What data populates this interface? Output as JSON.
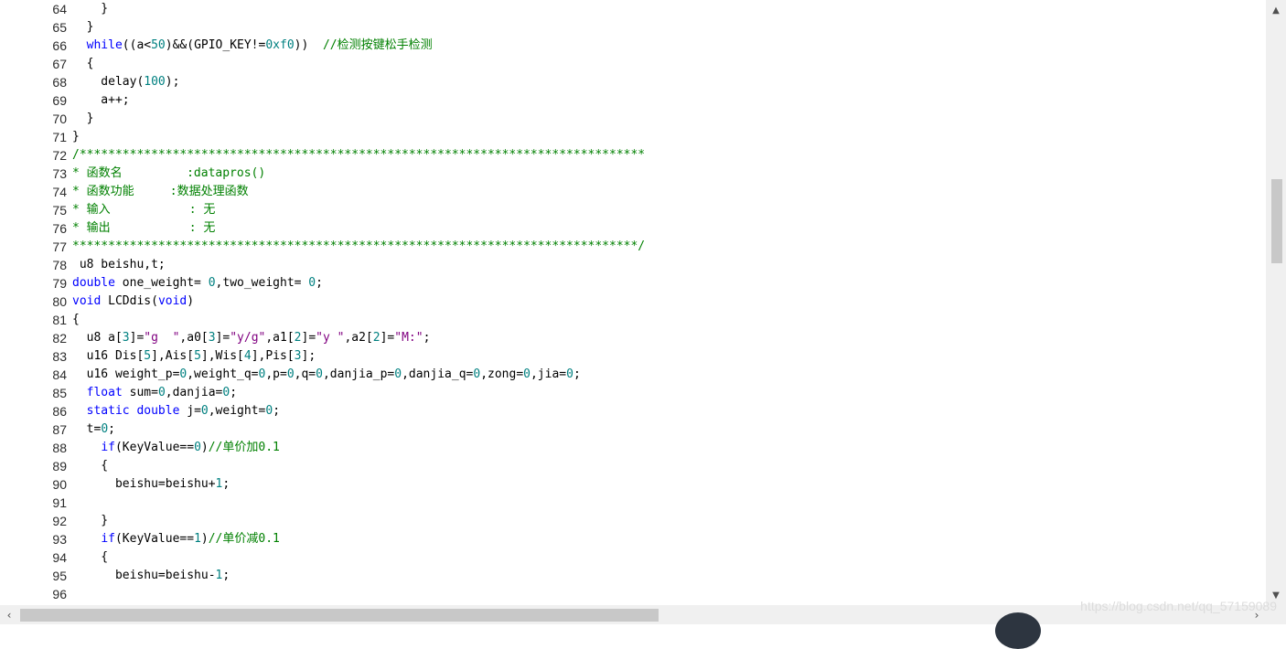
{
  "editor": {
    "lines": [
      {
        "num": "64",
        "segs": [
          {
            "t": "    }",
            "c": ""
          }
        ]
      },
      {
        "num": "65",
        "segs": [
          {
            "t": "  }",
            "c": ""
          }
        ]
      },
      {
        "num": "66",
        "segs": [
          {
            "t": "  ",
            "c": ""
          },
          {
            "t": "while",
            "c": "kw"
          },
          {
            "t": "((a<",
            "c": ""
          },
          {
            "t": "50",
            "c": "nm"
          },
          {
            "t": ")&&(GPIO_KEY!=",
            "c": ""
          },
          {
            "t": "0xf0",
            "c": "nm"
          },
          {
            "t": "))  ",
            "c": ""
          },
          {
            "t": "//检测按键松手检测",
            "c": "cm"
          }
        ]
      },
      {
        "num": "67",
        "segs": [
          {
            "t": "  {",
            "c": ""
          }
        ]
      },
      {
        "num": "68",
        "segs": [
          {
            "t": "    delay(",
            "c": ""
          },
          {
            "t": "100",
            "c": "nm"
          },
          {
            "t": ");",
            "c": ""
          }
        ]
      },
      {
        "num": "69",
        "segs": [
          {
            "t": "    a++;",
            "c": ""
          }
        ]
      },
      {
        "num": "70",
        "segs": [
          {
            "t": "  }",
            "c": ""
          }
        ]
      },
      {
        "num": "71",
        "segs": [
          {
            "t": "}",
            "c": ""
          }
        ]
      },
      {
        "num": "72",
        "segs": [
          {
            "t": "/*******************************************************************************",
            "c": "cm"
          }
        ]
      },
      {
        "num": "73",
        "segs": [
          {
            "t": "* 函数名         :datapros()",
            "c": "cm"
          }
        ]
      },
      {
        "num": "74",
        "segs": [
          {
            "t": "* 函数功能     :数据处理函数",
            "c": "cm"
          }
        ]
      },
      {
        "num": "75",
        "segs": [
          {
            "t": "* 输入           : 无",
            "c": "cm"
          }
        ]
      },
      {
        "num": "76",
        "segs": [
          {
            "t": "* 输出           : 无",
            "c": "cm"
          }
        ]
      },
      {
        "num": "77",
        "segs": [
          {
            "t": "*******************************************************************************/",
            "c": "cm"
          }
        ]
      },
      {
        "num": "78",
        "segs": [
          {
            "t": " u8 beishu,t;",
            "c": ""
          }
        ]
      },
      {
        "num": "79",
        "segs": [
          {
            "t": "double",
            "c": "kw"
          },
          {
            "t": " one_weight= ",
            "c": ""
          },
          {
            "t": "0",
            "c": "nm"
          },
          {
            "t": ",two_weight= ",
            "c": ""
          },
          {
            "t": "0",
            "c": "nm"
          },
          {
            "t": ";",
            "c": ""
          }
        ]
      },
      {
        "num": "80",
        "segs": [
          {
            "t": "void",
            "c": "kw"
          },
          {
            "t": " LCDdis(",
            "c": ""
          },
          {
            "t": "void",
            "c": "kw"
          },
          {
            "t": ")",
            "c": ""
          }
        ]
      },
      {
        "num": "81",
        "segs": [
          {
            "t": "{",
            "c": ""
          }
        ]
      },
      {
        "num": "82",
        "segs": [
          {
            "t": "  u8 a[",
            "c": ""
          },
          {
            "t": "3",
            "c": "nm"
          },
          {
            "t": "]=",
            "c": ""
          },
          {
            "t": "\"g  \"",
            "c": "st"
          },
          {
            "t": ",a0[",
            "c": ""
          },
          {
            "t": "3",
            "c": "nm"
          },
          {
            "t": "]=",
            "c": ""
          },
          {
            "t": "\"y/g\"",
            "c": "st"
          },
          {
            "t": ",a1[",
            "c": ""
          },
          {
            "t": "2",
            "c": "nm"
          },
          {
            "t": "]=",
            "c": ""
          },
          {
            "t": "\"y \"",
            "c": "st"
          },
          {
            "t": ",a2[",
            "c": ""
          },
          {
            "t": "2",
            "c": "nm"
          },
          {
            "t": "]=",
            "c": ""
          },
          {
            "t": "\"M:\"",
            "c": "st"
          },
          {
            "t": ";",
            "c": ""
          }
        ]
      },
      {
        "num": "83",
        "segs": [
          {
            "t": "  u16 Dis[",
            "c": ""
          },
          {
            "t": "5",
            "c": "nm"
          },
          {
            "t": "],Ais[",
            "c": ""
          },
          {
            "t": "5",
            "c": "nm"
          },
          {
            "t": "],Wis[",
            "c": ""
          },
          {
            "t": "4",
            "c": "nm"
          },
          {
            "t": "],Pis[",
            "c": ""
          },
          {
            "t": "3",
            "c": "nm"
          },
          {
            "t": "];",
            "c": ""
          }
        ]
      },
      {
        "num": "84",
        "segs": [
          {
            "t": "  u16 weight_p=",
            "c": ""
          },
          {
            "t": "0",
            "c": "nm"
          },
          {
            "t": ",weight_q=",
            "c": ""
          },
          {
            "t": "0",
            "c": "nm"
          },
          {
            "t": ",p=",
            "c": ""
          },
          {
            "t": "0",
            "c": "nm"
          },
          {
            "t": ",q=",
            "c": ""
          },
          {
            "t": "0",
            "c": "nm"
          },
          {
            "t": ",danjia_p=",
            "c": ""
          },
          {
            "t": "0",
            "c": "nm"
          },
          {
            "t": ",danjia_q=",
            "c": ""
          },
          {
            "t": "0",
            "c": "nm"
          },
          {
            "t": ",zong=",
            "c": ""
          },
          {
            "t": "0",
            "c": "nm"
          },
          {
            "t": ",jia=",
            "c": ""
          },
          {
            "t": "0",
            "c": "nm"
          },
          {
            "t": ";",
            "c": ""
          }
        ]
      },
      {
        "num": "85",
        "segs": [
          {
            "t": "  ",
            "c": ""
          },
          {
            "t": "float",
            "c": "kw"
          },
          {
            "t": " sum=",
            "c": ""
          },
          {
            "t": "0",
            "c": "nm"
          },
          {
            "t": ",danjia=",
            "c": ""
          },
          {
            "t": "0",
            "c": "nm"
          },
          {
            "t": ";",
            "c": ""
          }
        ]
      },
      {
        "num": "86",
        "segs": [
          {
            "t": "  ",
            "c": ""
          },
          {
            "t": "static",
            "c": "kw"
          },
          {
            "t": " ",
            "c": ""
          },
          {
            "t": "double",
            "c": "kw"
          },
          {
            "t": " j=",
            "c": ""
          },
          {
            "t": "0",
            "c": "nm"
          },
          {
            "t": ",weight=",
            "c": ""
          },
          {
            "t": "0",
            "c": "nm"
          },
          {
            "t": ";",
            "c": ""
          }
        ]
      },
      {
        "num": "87",
        "segs": [
          {
            "t": "  t=",
            "c": ""
          },
          {
            "t": "0",
            "c": "nm"
          },
          {
            "t": ";",
            "c": ""
          }
        ]
      },
      {
        "num": "88",
        "segs": [
          {
            "t": "    ",
            "c": ""
          },
          {
            "t": "if",
            "c": "kw"
          },
          {
            "t": "(KeyValue==",
            "c": ""
          },
          {
            "t": "0",
            "c": "nm"
          },
          {
            "t": ")",
            "c": ""
          },
          {
            "t": "//单价加0.1",
            "c": "cm"
          }
        ]
      },
      {
        "num": "89",
        "segs": [
          {
            "t": "    {",
            "c": ""
          }
        ]
      },
      {
        "num": "90",
        "segs": [
          {
            "t": "      beishu=beishu+",
            "c": ""
          },
          {
            "t": "1",
            "c": "nm"
          },
          {
            "t": ";",
            "c": ""
          }
        ]
      },
      {
        "num": "91",
        "segs": [
          {
            "t": "",
            "c": ""
          }
        ]
      },
      {
        "num": "92",
        "segs": [
          {
            "t": "    }",
            "c": ""
          }
        ]
      },
      {
        "num": "93",
        "segs": [
          {
            "t": "    ",
            "c": ""
          },
          {
            "t": "if",
            "c": "kw"
          },
          {
            "t": "(KeyValue==",
            "c": ""
          },
          {
            "t": "1",
            "c": "nm"
          },
          {
            "t": ")",
            "c": ""
          },
          {
            "t": "//单价减0.1",
            "c": "cm"
          }
        ]
      },
      {
        "num": "94",
        "segs": [
          {
            "t": "    {",
            "c": ""
          }
        ]
      },
      {
        "num": "95",
        "segs": [
          {
            "t": "      beishu=beishu-",
            "c": ""
          },
          {
            "t": "1",
            "c": "nm"
          },
          {
            "t": ";",
            "c": ""
          }
        ]
      },
      {
        "num": "96",
        "segs": [
          {
            "t": "",
            "c": ""
          }
        ]
      }
    ]
  },
  "scroll": {
    "up_icon": "chevron-up-icon",
    "down_icon": "chevron-down-icon",
    "left_icon": "chevron-left-icon",
    "right_icon": "chevron-right-icon"
  },
  "watermark": "https://blog.csdn.net/qq_57159089",
  "colors": {
    "keyword": "#0000ff",
    "number": "#008080",
    "string": "#800080",
    "comment": "#008000"
  }
}
